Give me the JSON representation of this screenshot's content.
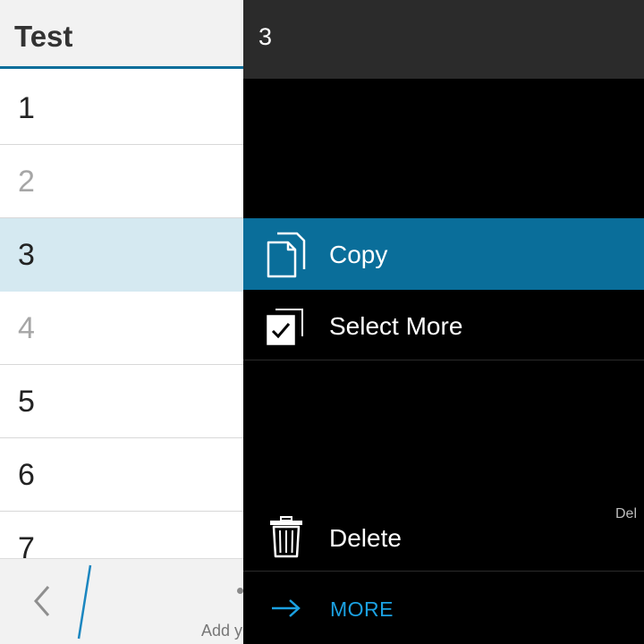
{
  "list_pane": {
    "title": "Test",
    "items": [
      {
        "label": "1",
        "state": "normal"
      },
      {
        "label": "2",
        "state": "dim"
      },
      {
        "label": "3",
        "state": "selected"
      },
      {
        "label": "4",
        "state": "dim"
      },
      {
        "label": "5",
        "state": "normal"
      },
      {
        "label": "6",
        "state": "normal"
      },
      {
        "label": "7",
        "state": "normal"
      }
    ],
    "bottom_bar": {
      "hint_text": "Add y"
    }
  },
  "context_menu": {
    "header_title": "3",
    "items": [
      {
        "label": "Copy",
        "icon": "copy-icon",
        "active": true
      },
      {
        "label": "Select More",
        "icon": "select-more-icon",
        "active": false
      },
      {
        "label": "Delete",
        "icon": "trash-icon",
        "active": false,
        "shortcut": "Del"
      }
    ],
    "more_label": "MORE",
    "colors": {
      "accent": "#0a6e9a",
      "link": "#1ba1e2",
      "selected_row": "#d5e9f1",
      "menu_bg": "#000000",
      "menu_header_bg": "#2b2b2b"
    }
  }
}
